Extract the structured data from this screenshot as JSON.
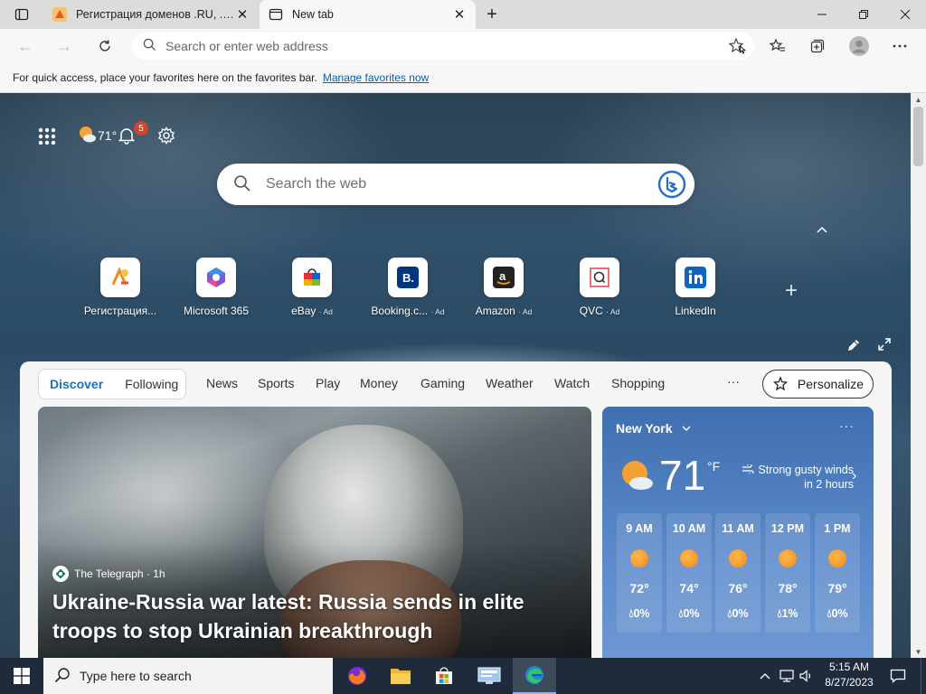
{
  "browser": {
    "tabs": [
      {
        "title": "Регистрация доменов .RU, .РФ у"
      },
      {
        "title": "New tab"
      }
    ],
    "address_placeholder": "Search or enter web address",
    "favorites_bar": {
      "text": "For quick access, place your favorites here on the favorites bar.",
      "link": "Manage favorites now"
    }
  },
  "ntp": {
    "weather_chip": "71°",
    "notification_count": "5",
    "search_placeholder": "Search the web",
    "quick_links": [
      {
        "label": "Регистрация...",
        "ad": "",
        "icon": "domain-registrar-icon"
      },
      {
        "label": "Microsoft 365",
        "ad": "",
        "icon": "microsoft-365-icon"
      },
      {
        "label": "eBay",
        "ad": "· Ad",
        "icon": "ebay-icon"
      },
      {
        "label": "Booking.c...",
        "ad": "· Ad",
        "icon": "booking-icon"
      },
      {
        "label": "Amazon",
        "ad": "· Ad",
        "icon": "amazon-icon"
      },
      {
        "label": "QVC",
        "ad": "· Ad",
        "icon": "qvc-icon"
      },
      {
        "label": "LinkedIn",
        "ad": "",
        "icon": "linkedin-icon"
      }
    ]
  },
  "feed": {
    "segment": [
      "Discover",
      "Following"
    ],
    "tabs": [
      "News",
      "Sports",
      "Play",
      "Money",
      "Gaming",
      "Weather",
      "Watch",
      "Shopping"
    ],
    "more": "···",
    "personalize": "Personalize",
    "hero": {
      "source": "The Telegraph · 1h",
      "headline": "Ukraine-Russia war latest: Russia sends in elite troops to stop Ukrainian breakthrough"
    },
    "weather": {
      "city": "New York",
      "temp": "71",
      "unit": "°F",
      "alert": "Strong gusty winds in 2 hours",
      "more": "···",
      "hourly": [
        {
          "time": "9 AM",
          "temp": "72°",
          "precip": "0%"
        },
        {
          "time": "10 AM",
          "temp": "74°",
          "precip": "0%"
        },
        {
          "time": "11 AM",
          "temp": "76°",
          "precip": "0%"
        },
        {
          "time": "12 PM",
          "temp": "78°",
          "precip": "1%"
        },
        {
          "time": "1 PM",
          "temp": "79°",
          "precip": "0%"
        }
      ]
    }
  },
  "taskbar": {
    "search_placeholder": "Type here to search",
    "time": "5:15 AM",
    "date": "8/27/2023"
  },
  "colors": {
    "accent": "#1a6fc4",
    "taskbar": "#1f2b3a",
    "badge": "#d4432b"
  }
}
